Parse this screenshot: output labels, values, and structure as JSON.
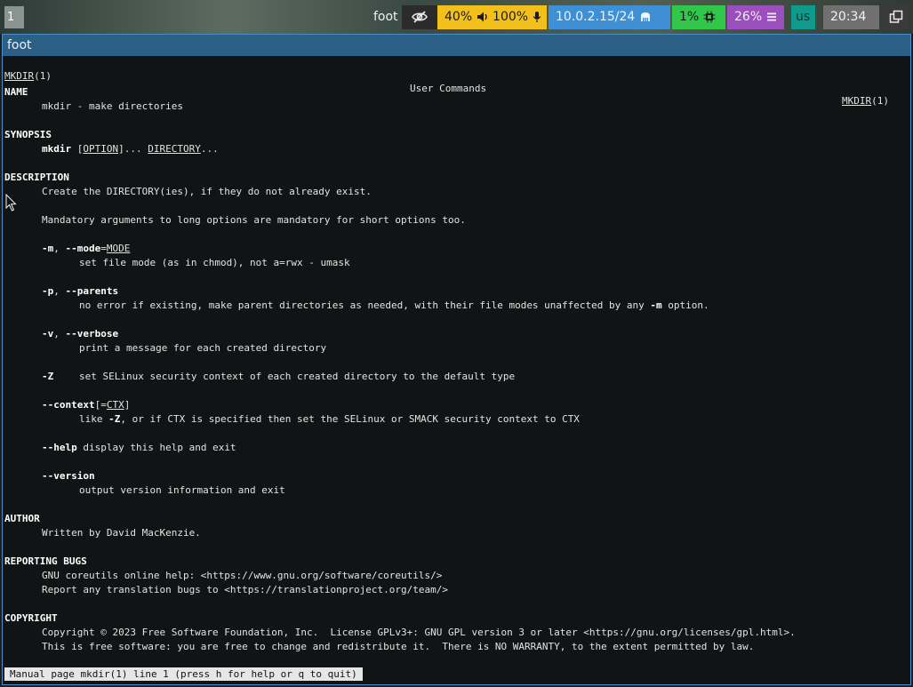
{
  "bar": {
    "workspace": "1",
    "window_title": "foot",
    "idle_icon": "eye-off-icon",
    "volume": "40%",
    "volume_icon": "speaker-icon",
    "mic": "100%",
    "mic_icon": "microphone-icon",
    "network": "10.0.2.15/24",
    "network_icon": "ethernet-icon",
    "cpu": "1%",
    "cpu_icon": "cpu-icon",
    "memory": "26%",
    "memory_icon": "memory-icon",
    "language": "us",
    "clock": "20:34",
    "tray_icon": "window-switch-icon"
  },
  "window": {
    "title": "foot"
  },
  "man": {
    "header_left": "MKDIR",
    "header_left_suffix": "(1)",
    "header_center": "User Commands",
    "header_right": "MKDIR",
    "header_right_suffix": "(1)",
    "name_heading": "NAME",
    "name_text": "mkdir - make directories",
    "synopsis_heading": "SYNOPSIS",
    "syn_cmd": "mkdir",
    "syn_option": "OPTION",
    "syn_dots1": "]... ",
    "syn_directory": "DIRECTORY",
    "syn_dots2": "...",
    "description_heading": "DESCRIPTION",
    "desc_line1": "Create the DIRECTORY(ies), if they do not already exist.",
    "desc_line2": "Mandatory arguments to long options are mandatory for short options too.",
    "opt_m": "-m",
    "opt_mode": "--mode",
    "opt_mode_arg": "MODE",
    "opt_m_desc": "set file mode (as in chmod), not a=rwx - umask",
    "opt_p": "-p",
    "opt_parents": "--parents",
    "opt_p_desc_a": "no error if existing, make parent directories as needed, with their file modes unaffected by any ",
    "opt_p_desc_b": "-m",
    "opt_p_desc_c": " option.",
    "opt_v": "-v",
    "opt_verbose": "--verbose",
    "opt_v_desc": "print a message for each created directory",
    "opt_Z": "-Z",
    "opt_Z_desc": "set SELinux security context of each created directory to the default type",
    "opt_context": "--context",
    "opt_context_arg": "CTX",
    "opt_context_desc_a": "like ",
    "opt_context_desc_b": "-Z",
    "opt_context_desc_c": ", or if CTX is specified then set the SELinux or SMACK security context to CTX",
    "opt_help": "--help",
    "opt_help_desc": " display this help and exit",
    "opt_version": "--version",
    "opt_version_desc": "output version information and exit",
    "author_heading": "AUTHOR",
    "author_text": "Written by David MacKenzie.",
    "bugs_heading": "REPORTING BUGS",
    "bugs_line1": "GNU coreutils online help: <https://www.gnu.org/software/coreutils/>",
    "bugs_line2": "Report any translation bugs to <https://translationproject.org/team/>",
    "copyright_heading": "COPYRIGHT",
    "copyright_line1": "Copyright © 2023 Free Software Foundation, Inc.  License GPLv3+: GNU GPL version 3 or later <https://gnu.org/licenses/gpl.html>.",
    "copyright_line2": "This is free software: you are free to change and redistribute it.  There is NO WARRANTY, to the extent permitted by law."
  },
  "status": "Manual page mkdir(1) line 1 (press h for help or q to quit)",
  "colors": {
    "audio_bg": "#f2c01c",
    "network_bg": "#3e8fd3",
    "cpu_bg": "#30c74a",
    "memory_bg": "#9a4fbd",
    "language_bg": "#109a8b",
    "clock_bg": "#707070",
    "titlebar_bg": "#2c5f86",
    "terminal_bg": "#111415"
  }
}
